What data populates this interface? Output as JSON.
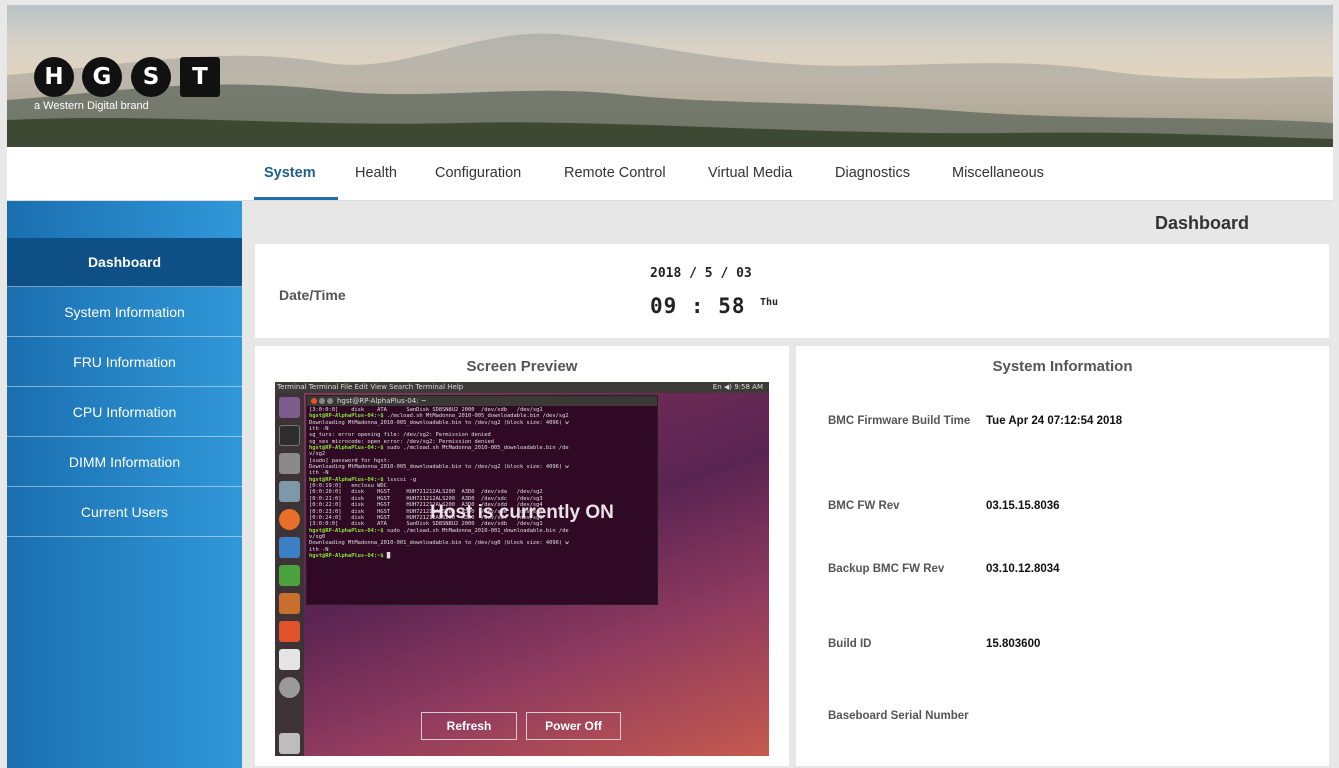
{
  "brand": {
    "letters": [
      "H",
      "G",
      "S",
      "T"
    ],
    "tagline": "a Western Digital brand"
  },
  "nav": {
    "tabs": [
      {
        "label": "System",
        "active": true
      },
      {
        "label": "Health"
      },
      {
        "label": "Configuration"
      },
      {
        "label": "Remote Control"
      },
      {
        "label": "Virtual Media"
      },
      {
        "label": "Diagnostics"
      },
      {
        "label": "Miscellaneous"
      }
    ]
  },
  "sidebar": {
    "items": [
      {
        "label": "Dashboard",
        "active": true
      },
      {
        "label": "System Information"
      },
      {
        "label": "FRU Information"
      },
      {
        "label": "CPU Information"
      },
      {
        "label": "DIMM Information"
      },
      {
        "label": "Current Users"
      }
    ]
  },
  "main": {
    "title": "Dashboard",
    "datetime": {
      "label": "Date/Time",
      "date": "2018 / 5 / 03",
      "time": "09 : 58",
      "day": "Thu"
    },
    "preview": {
      "title": "Screen Preview",
      "host_status": "Host is currently ON",
      "refresh_label": "Refresh",
      "power_off_label": "Power Off",
      "topbar_left": "Terminal  Terminal  File  Edit  View  Search  Terminal  Help",
      "topbar_right": "En  ◀)  9:58 AM",
      "terminal_title": "hgst@RP-AlphaPlus-04: ~",
      "terminal_lines": [
        "[3:0:0:0]    disk    ATA      SanDisk SD8SN8U2 2000  /dev/sdb   /dev/sg1",
        "hgst@RP-AlphaPlus-04:~$ ./mcload.sh MtMadonna_2010-005_downloadable.bin /dev/sg2",
        "Downloading MtMadonna_2010-005_downloadable.bin to /dev/sg2 (block size: 4096) w",
        "ith -N",
        "sg_turs: error opening file: /dev/sg2: Permission denied",
        "sg_ses_microcode: open error: /dev/sg2: Permission denied",
        "hgst@RP-AlphaPlus-04:~$ sudo ./mcload.sh MtMadonna_2010-005_downloadable.bin /de",
        "v/sg2",
        "[sudo] password for hgst:",
        "Downloading MtMadonna_2010-005_downloadable.bin to /dev/sg2 (block size: 4096) w",
        "ith -N",
        "hgst@RP-AlphaPlus-04:~$ lsscsi -g",
        "[0:0:19:0]   enclosu WDC      ",
        "[0:0:20:0]   disk    HGST     HUH721212ALS200  A3D0  /dev/sda   /dev/sg2",
        "[0:0:21:0]   disk    HGST     HUH721212ALS200  A3D0  /dev/sdc   /dev/sg3",
        "[0:0:22:0]   disk    HGST     HUH721212ALS200  A3D0  /dev/sdd   /dev/sg4",
        "[0:0:23:0]   disk    HGST     HUH721212ALS200  A3D0  /dev/sde   /dev/sg5",
        "[0:0:24:0]   disk    HGST     HUH721212ALS200  A3D0  /dev/sdf   /dev/sg6",
        "[3:0:0:0]    disk    ATA      SanDisk SD8SN8U2 2000  /dev/sdb   /dev/sg1",
        "hgst@RP-AlphaPlus-04:~$ sudo ./mcload.sh MtMadonna_2010-001_downloadable.bin /de",
        "v/sg0",
        "Downloading MtMadonna_2010-001_downloadable.bin to /dev/sg0 (block size: 4096) w",
        "ith -N",
        "hgst@RP-AlphaPlus-04:~$ █"
      ]
    },
    "system_info": {
      "title": "System Information",
      "rows": [
        {
          "label": "BMC Firmware Build Time",
          "value": "Tue Apr 24 07:12:54 2018"
        },
        {
          "label": "BMC FW Rev",
          "value": "03.15.15.8036"
        },
        {
          "label": "Backup BMC FW Rev",
          "value": "03.10.12.8034"
        },
        {
          "label": "Build ID",
          "value": "15.803600"
        },
        {
          "label": "Baseboard Serial Number",
          "value": ""
        }
      ]
    }
  },
  "colors": {
    "sidebar_active": "#0e4f86",
    "sidebar_bg": "#2a8ad0",
    "tab_active": "#1f5f8c",
    "terminal_bg": "#300a24"
  }
}
